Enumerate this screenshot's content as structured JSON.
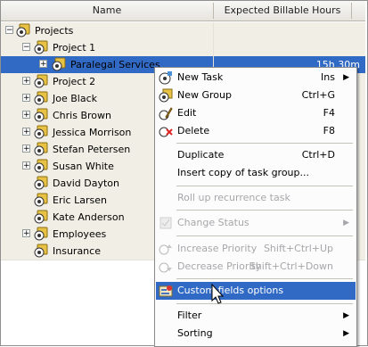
{
  "columns": {
    "name": "Name",
    "hours": "Expected Billable Hours"
  },
  "tree": {
    "root": "Projects",
    "project1": "Project 1",
    "paralegal": {
      "label": "Paralegal Services",
      "hours": "15h 30m"
    },
    "items": [
      "Project 2",
      "Joe Black",
      "Chris Brown",
      "Jessica Morrison",
      "Stefan Petersen",
      "Susan White",
      "David Dayton",
      "Eric Larsen",
      "Kate Anderson",
      "Employees",
      "Insurance"
    ]
  },
  "menu": {
    "new_task": "New Task",
    "new_task_key": "Ins",
    "new_group": "New Group",
    "new_group_key": "Ctrl+G",
    "edit": "Edit",
    "edit_key": "F4",
    "delete": "Delete",
    "delete_key": "F8",
    "duplicate": "Duplicate",
    "duplicate_key": "Ctrl+D",
    "insert_copy": "Insert copy of task group...",
    "rollup": "Roll up recurrence task",
    "change_status": "Change Status",
    "inc_priority": "Increase Priority",
    "inc_priority_key": "Shift+Ctrl+Up",
    "dec_priority": "Decrease Priority",
    "dec_priority_key": "Shift+Ctrl+Down",
    "custom_fields": "Custom fields options",
    "filter": "Filter",
    "sorting": "Sorting"
  },
  "colors": {
    "selection": "#316ac5",
    "group_row": "#f1efe5",
    "disabled": "#a7a6aa"
  },
  "icons": [
    "expand-toggle",
    "task-group-icon",
    "new-task-icon",
    "new-group-icon",
    "edit-icon",
    "delete-icon",
    "change-status-icon",
    "increase-priority-icon",
    "decrease-priority-icon",
    "custom-fields-icon",
    "mouse-cursor"
  ]
}
